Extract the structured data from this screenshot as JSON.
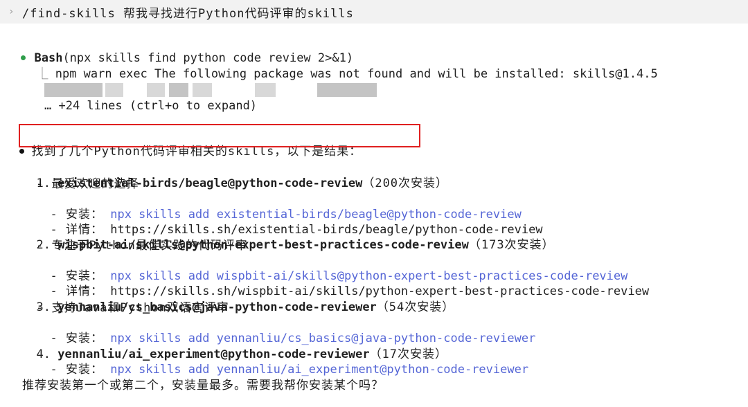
{
  "command": {
    "prompt": "›",
    "text": "/find-skills 帮我寻找进行Python代码评审的skills"
  },
  "bash": {
    "tool": "Bash",
    "args": "(npx skills find python code review 2>&1)",
    "tree_glyph": "⎿",
    "output": "npm warn exec The following package was not found and will be installed: skills@1.4.5",
    "collapsed": "… +24 lines (ctrl+o to expand)"
  },
  "answer": {
    "intro": "找到了几个Python代码评审相关的skills，以下是结果：",
    "items": [
      {
        "num": "1.",
        "name": "existential-birds/beagle@python-code-review",
        "count": "（200次安装）",
        "lines": [
          {
            "label": "- 最受欢迎的选择",
            "value": "",
            "type": "text"
          },
          {
            "label": "- 安装：",
            "value": "npx skills add existential-birds/beagle@python-code-review",
            "type": "link"
          },
          {
            "label": "- 详情：",
            "value": "https://skills.sh/existential-birds/beagle/python-code-review",
            "type": "text"
          }
        ]
      },
      {
        "num": "2.",
        "name": "wispbit-ai/skills@python-expert-best-practices-code-review",
        "count": "（173次安装）",
        "lines": [
          {
            "label": "- 专注于Python最佳实践的代码评审",
            "value": "",
            "type": "text"
          },
          {
            "label": "- 安装：",
            "value": "npx skills add wispbit-ai/skills@python-expert-best-practices-code-review",
            "type": "link"
          },
          {
            "label": "- 详情：",
            "value": "https://skills.sh/wispbit-ai/skills/python-expert-best-practices-code-review",
            "type": "text"
          }
        ]
      },
      {
        "num": "3.",
        "name": "yennanliu/cs_basics@java-python-code-reviewer",
        "count": "（54次安装）",
        "lines": [
          {
            "label": "- 支持Java和Python双语言评审",
            "value": "",
            "type": "text"
          },
          {
            "label": "- 安装：",
            "value": "npx skills add yennanliu/cs_basics@java-python-code-reviewer",
            "type": "link"
          }
        ]
      },
      {
        "num": "4.",
        "name": "yennanliu/ai_experiment@python-code-reviewer",
        "count": "（17次安装）",
        "lines": [
          {
            "label": "- 安装：",
            "value": "npx skills add yennanliu/ai_experiment@python-code-reviewer",
            "type": "link"
          }
        ]
      }
    ],
    "closing": "推荐安装第一个或第二个，安装量最多。需要我帮你安装某个吗？"
  }
}
